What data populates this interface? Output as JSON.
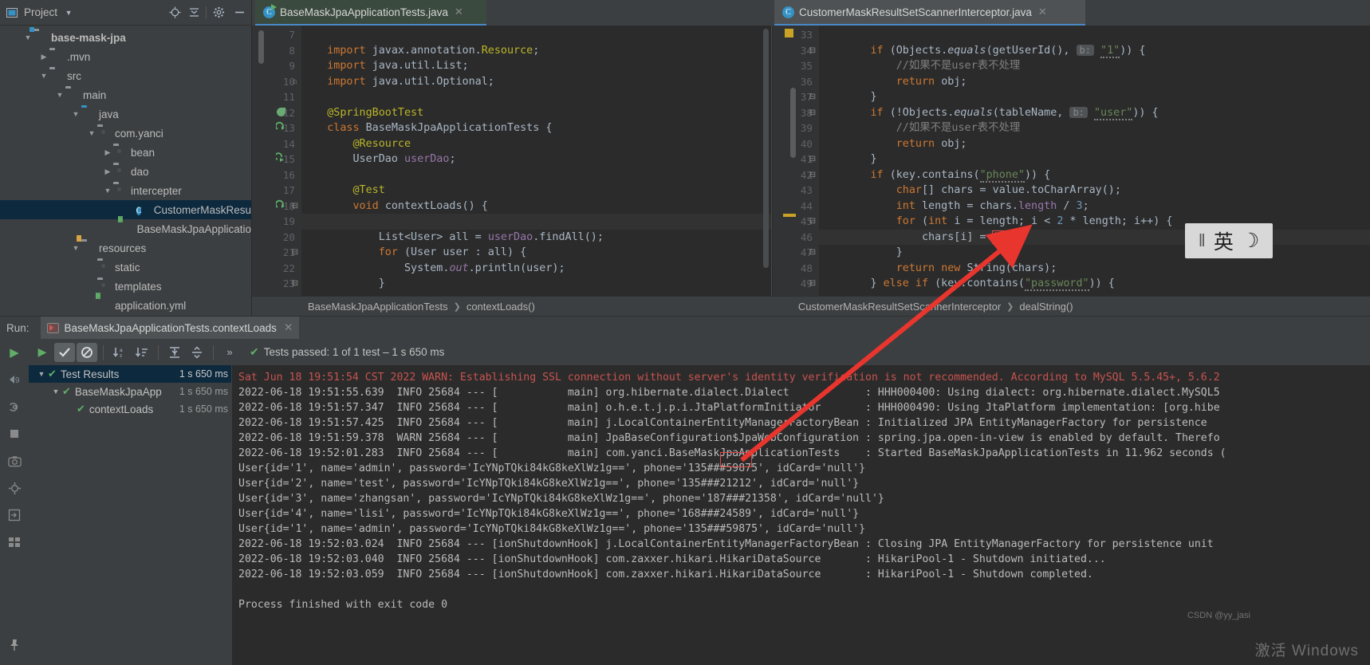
{
  "project_panel": {
    "title": "Project",
    "icons": [
      "project-view-icon",
      "locate-icon",
      "collapse-all-icon",
      "settings-gear-icon",
      "hide-icon"
    ],
    "tree": [
      {
        "label": "base-mask-jpa",
        "indent": 1,
        "twisty": "▼",
        "icon": "folder-module",
        "bold": true,
        "selected": false
      },
      {
        "label": ".mvn",
        "indent": 2,
        "twisty": "▶",
        "icon": "folder",
        "bold": false,
        "selected": false
      },
      {
        "label": "src",
        "indent": 2,
        "twisty": "▼",
        "icon": "folder",
        "bold": false,
        "selected": false
      },
      {
        "label": "main",
        "indent": 3,
        "twisty": "▼",
        "icon": "folder",
        "bold": false,
        "selected": false
      },
      {
        "label": "java",
        "indent": 4,
        "twisty": "▼",
        "icon": "folder-source",
        "bold": false,
        "selected": false
      },
      {
        "label": "com.yanci",
        "indent": 5,
        "twisty": "▼",
        "icon": "package",
        "bold": false,
        "selected": false
      },
      {
        "label": "bean",
        "indent": 6,
        "twisty": "▶",
        "icon": "package",
        "bold": false,
        "selected": false
      },
      {
        "label": "dao",
        "indent": 6,
        "twisty": "▶",
        "icon": "package",
        "bold": false,
        "selected": false
      },
      {
        "label": "intercepter",
        "indent": 6,
        "twisty": "▼",
        "icon": "package",
        "bold": false,
        "selected": false
      },
      {
        "label": "CustomerMaskResu",
        "indent": 8,
        "twisty": "",
        "icon": "java-class",
        "bold": false,
        "selected": true
      },
      {
        "label": "BaseMaskJpaApplicatio",
        "indent": 8,
        "twisty": "",
        "icon": "spring-boot",
        "bold": false,
        "selected": false
      },
      {
        "label": "resources",
        "indent": 4,
        "twisty": "▼",
        "icon": "folder-resources",
        "bold": false,
        "selected": false
      },
      {
        "label": "static",
        "indent": 5,
        "twisty": "",
        "icon": "package",
        "bold": false,
        "selected": false
      },
      {
        "label": "templates",
        "indent": 5,
        "twisty": "",
        "icon": "package",
        "bold": false,
        "selected": false
      },
      {
        "label": "application.yml",
        "indent": 5,
        "twisty": "",
        "icon": "spring-yaml",
        "bold": false,
        "selected": false
      }
    ]
  },
  "editor": {
    "tabs": [
      {
        "label": "BaseMaskJpaApplicationTests.java",
        "icon": "java-test-class-icon",
        "active": true,
        "closable": true
      },
      {
        "label": "CustomerMaskResultSetScannerInterceptor.java",
        "icon": "java-class-icon",
        "active": true,
        "closable": true
      }
    ],
    "left": {
      "first_line_number": 7,
      "lines": [
        {
          "n": 7,
          "html": ""
        },
        {
          "n": 8,
          "html": "    <span class='kw'>import</span> <span class='txt'>javax.annotation.</span><span class='anno'>Resource</span><span class='txt'>;</span>"
        },
        {
          "n": 9,
          "html": "    <span class='kw'>import</span> <span class='txt'>java.util.List;</span>"
        },
        {
          "n": 10,
          "html": "    <span class='kw'>import</span> <span class='txt'>java.util.Optional;</span>",
          "fold": "⌐"
        },
        {
          "n": 11,
          "html": ""
        },
        {
          "n": 12,
          "html": "    <span class='anno'>@SpringBootTest</span>",
          "glyph": "spring-leaf"
        },
        {
          "n": 13,
          "html": "    <span class='kw'>class</span> <span class='txt'>BaseMaskJpaApplicationTests {</span>",
          "glyph": "run-test"
        },
        {
          "n": 14,
          "html": "        <span class='anno'>@Resource</span>"
        },
        {
          "n": 15,
          "html": "        <span class='txt'>UserDao </span><span class='fld'>userDao</span><span class='txt'>;</span>",
          "glyph": "bean-nav"
        },
        {
          "n": 16,
          "html": ""
        },
        {
          "n": 17,
          "html": "        <span class='anno'>@Test</span>"
        },
        {
          "n": 18,
          "html": "        <span class='kw'>void</span> <span class='txt'>contextLoads() {</span>",
          "glyph": "run-test",
          "fold": "−"
        },
        {
          "n": 19,
          "html": "",
          "caret": true
        },
        {
          "n": 20,
          "html": "            <span class='txt'>List&lt;User&gt; all = </span><span class='fld'>userDao</span><span class='txt'>.findAll();</span>"
        },
        {
          "n": 21,
          "html": "            <span class='kw'>for</span> <span class='txt'>(User user : all) {</span>",
          "fold": "−"
        },
        {
          "n": 22,
          "html": "                <span class='txt'>System.</span><span class='fld itl'>out</span><span class='txt'>.println(user);</span>"
        },
        {
          "n": 23,
          "html": "            <span class='txt'>}</span>",
          "fold": "−"
        }
      ]
    },
    "right": {
      "first_line_number": 33,
      "lines": [
        {
          "n": 33,
          "html": "",
          "marker": "warning-stripe"
        },
        {
          "n": 34,
          "html": "        <span class='kw'>if</span> <span class='txt'>(Objects.</span><span class='itl txt'>equals</span><span class='txt'>(getUserId(), </span><span class='hintpill'>b:</span> <span class='str squig'>\"1\"</span><span class='txt'>)) {</span>",
          "fold": "−"
        },
        {
          "n": 35,
          "html": "            <span class='cmt'>//如果不是user表不处理</span>"
        },
        {
          "n": 36,
          "html": "            <span class='kw'>return</span> <span class='txt'>obj;</span>"
        },
        {
          "n": 37,
          "html": "        <span class='txt'>}</span>",
          "fold": "−"
        },
        {
          "n": 38,
          "html": "        <span class='kw'>if</span> <span class='txt'>(!Objects.</span><span class='itl txt'>equals</span><span class='txt'>(tableName, </span><span class='hintpill'>b:</span> <span class='str squig'>\"user\"</span><span class='txt'>)) {</span>",
          "fold": "−"
        },
        {
          "n": 39,
          "html": "            <span class='cmt'>//如果不是user表不处理</span>"
        },
        {
          "n": 40,
          "html": "            <span class='kw'>return</span> <span class='txt'>obj;</span>"
        },
        {
          "n": 41,
          "html": "        <span class='txt'>}</span>",
          "fold": "−"
        },
        {
          "n": 42,
          "html": "        <span class='kw'>if</span> <span class='txt'>(key.contains(</span><span class='str squig'>\"phone\"</span><span class='txt'>)) {</span>",
          "fold": "−"
        },
        {
          "n": 43,
          "html": "            <span class='kw'>char</span><span class='txt'>[] chars = value.toCharArray();</span>"
        },
        {
          "n": 44,
          "html": "            <span class='kw'>int</span> <span class='txt'>length = chars.</span><span class='fld'>length</span> <span class='txt'>/ </span><span class='num'>3</span><span class='txt'>;</span>"
        },
        {
          "n": 45,
          "html": "            <span class='kw'>for</span> <span class='txt'>(</span><span class='kw'>int</span> <span class='txt'>i = length; i &lt; </span><span class='num'>2</span> <span class='txt'>* length; i++) {</span>",
          "fold": "−",
          "marker": "modified-stripe"
        },
        {
          "n": 46,
          "html": "                <span class='txt'>chars[i] = </span><span class='str boxed'>'#'</span><span class='txt'>;</span>",
          "caret": true
        },
        {
          "n": 47,
          "html": "            <span class='txt'>}</span>",
          "fold": "−"
        },
        {
          "n": 48,
          "html": "            <span class='kw'>return</span> <span class='kw'>new</span> <span class='txt'>String(chars);</span>"
        },
        {
          "n": 49,
          "html": "        <span class='txt'>} </span><span class='kw'>else if</span> <span class='txt'>(key.contains(</span><span class='str squig'>\"password\"</span><span class='txt'>)) {</span>",
          "fold": "−"
        }
      ]
    },
    "breadcrumbs_left": [
      "BaseMaskJpaApplicationTests",
      "contextLoads()"
    ],
    "breadcrumbs_right": [
      "CustomerMaskResultSetScannerInterceptor",
      "dealString()"
    ]
  },
  "run_panel": {
    "run_label": "Run:",
    "tab_label": "BaseMaskJpaApplicationTests.contextLoads",
    "toolbar_icons": [
      "rerun-icon",
      "show-passed-icon",
      "show-ignored-icon",
      "sort-alphabetically-icon",
      "sort-by-duration-icon",
      "expand-all-icon",
      "collapse-all-icon",
      "more-icon"
    ],
    "status_text": "Tests passed: 1 of 1 test – 1 s 650 ms",
    "side_icons": [
      "run-tool-icon",
      "debug-tool-icon",
      "build-tool-icon",
      "stop-icon",
      "screenshot-icon",
      "coverage-icon",
      "import-icon",
      "layout-icon",
      "pin-icon"
    ],
    "results": [
      {
        "label": "Test Results",
        "indent": 0,
        "twisty": "▼",
        "time": "1 s 650 ms",
        "selected": true
      },
      {
        "label": "BaseMaskJpaApp",
        "indent": 1,
        "twisty": "▼",
        "time": "1 s 650 ms",
        "selected": false
      },
      {
        "label": "contextLoads",
        "indent": 2,
        "twisty": "",
        "time": "1 s 650 ms",
        "selected": false
      }
    ],
    "console": [
      {
        "text": "Sat Jun 18 19:51:54 CST 2022 WARN: Establishing SSL connection without server's identity verification is not recommended. According to MySQL 5.5.45+, 5.6.2",
        "warn": true
      },
      {
        "text": "2022-06-18 19:51:55.639  INFO 25684 --- [           main] org.hibernate.dialect.Dialect            : HHH000400: Using dialect: org.hibernate.dialect.MySQL5",
        "warn": false
      },
      {
        "text": "2022-06-18 19:51:57.347  INFO 25684 --- [           main] o.h.e.t.j.p.i.JtaPlatformInitiator       : HHH000490: Using JtaPlatform implementation: [org.hibe",
        "warn": false
      },
      {
        "text": "2022-06-18 19:51:57.425  INFO 25684 --- [           main] j.LocalContainerEntityManagerFactoryBean : Initialized JPA EntityManagerFactory for persistence ",
        "warn": false
      },
      {
        "text": "2022-06-18 19:51:59.378  WARN 25684 --- [           main] JpaBaseConfiguration$JpaWebConfiguration : spring.jpa.open-in-view is enabled by default. Therefo",
        "warn": false
      },
      {
        "text": "2022-06-18 19:52:01.283  INFO 25684 --- [           main] com.yanci.BaseMaskJpaApplicationTests    : Started BaseMaskJpaApplicationTests in 11.962 seconds (",
        "warn": false
      },
      {
        "text": "User{id='1', name='admin', password='IcYNpTQki84kG8keXlWz1g==', phone='135###59875', idCard='null'}",
        "warn": false
      },
      {
        "text": "User{id='2', name='test', password='IcYNpTQki84kG8keXlWz1g==', phone='135###21212', idCard='null'}",
        "warn": false
      },
      {
        "text": "User{id='3', name='zhangsan', password='IcYNpTQki84kG8keXlWz1g==', phone='187###21358', idCard='null'}",
        "warn": false
      },
      {
        "text": "User{id='4', name='lisi', password='IcYNpTQki84kG8keXlWz1g==', phone='168###24589', idCard='null'}",
        "warn": false
      },
      {
        "text": "User{id='1', name='admin', password='IcYNpTQki84kG8keXlWz1g==', phone='135###59875', idCard='null'}",
        "warn": false
      },
      {
        "text": "2022-06-18 19:52:03.024  INFO 25684 --- [ionShutdownHook] j.LocalContainerEntityManagerFactoryBean : Closing JPA EntityManagerFactory for persistence unit ",
        "warn": false
      },
      {
        "text": "2022-06-18 19:52:03.040  INFO 25684 --- [ionShutdownHook] com.zaxxer.hikari.HikariDataSource       : HikariPool-1 - Shutdown initiated...",
        "warn": false
      },
      {
        "text": "2022-06-18 19:52:03.059  INFO 25684 --- [ionShutdownHook] com.zaxxer.hikari.HikariDataSource       : HikariPool-1 - Shutdown completed.",
        "warn": false
      },
      {
        "text": "",
        "warn": false
      },
      {
        "text": "Process finished with exit code 0",
        "warn": false
      }
    ]
  },
  "overlays": {
    "ime_badge_main": "英",
    "ime_badge_bar": "‖",
    "ime_badge_moon": "☽",
    "watermark": "激活 Windows",
    "csdn": "CSDN @yy_jasi",
    "annotation_color": "#e04a4a"
  }
}
